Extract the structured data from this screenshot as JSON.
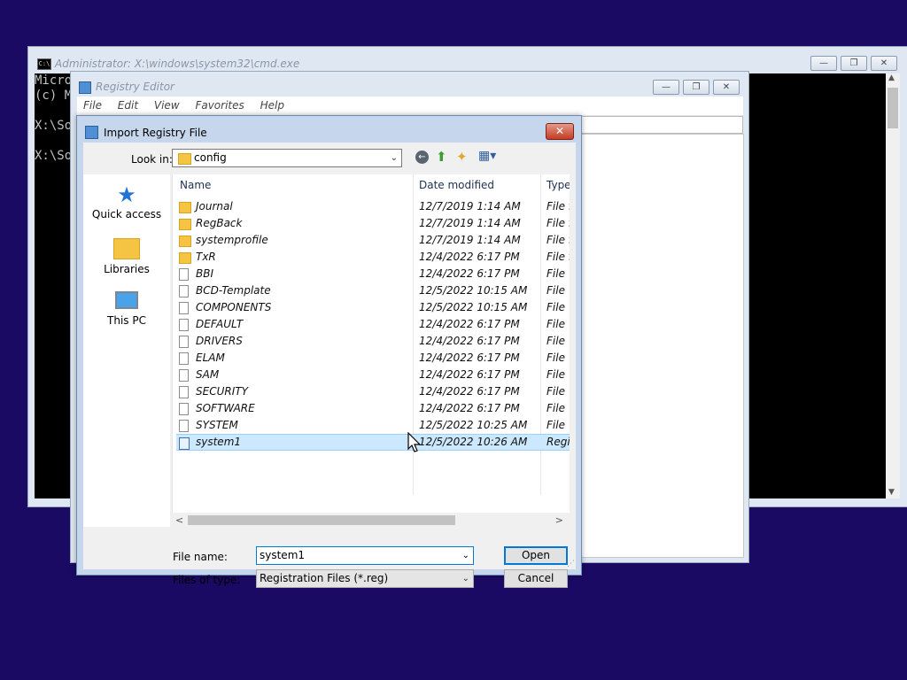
{
  "cmd_window": {
    "title": "Administrator: X:\\windows\\system32\\cmd.exe",
    "lines": [
      "Micro",
      "(c) M",
      "",
      "X:\\So",
      "",
      "X:\\So"
    ],
    "caption_buttons": {
      "minimize": "—",
      "restore": "❐",
      "close": "✕"
    }
  },
  "registry_editor": {
    "title": "Registry Editor",
    "menu": [
      "File",
      "Edit",
      "View",
      "Favorites",
      "Help"
    ],
    "caption_buttons": {
      "minimize": "—",
      "restore": "❐",
      "close": "✕"
    }
  },
  "dialog": {
    "title": "Import Registry File",
    "close_glyph": "✕",
    "look_in_label": "Look in:",
    "look_in_value": "config",
    "places": [
      "Quick access",
      "Libraries",
      "This PC"
    ],
    "columns": {
      "name": "Name",
      "date": "Date modified",
      "type": "Type"
    },
    "files": [
      {
        "name": "Journal",
        "date": "12/7/2019 1:14 AM",
        "type": "File fo",
        "kind": "folder"
      },
      {
        "name": "RegBack",
        "date": "12/7/2019 1:14 AM",
        "type": "File fo",
        "kind": "folder"
      },
      {
        "name": "systemprofile",
        "date": "12/7/2019 1:14 AM",
        "type": "File fo",
        "kind": "folder"
      },
      {
        "name": "TxR",
        "date": "12/4/2022 6:17 PM",
        "type": "File fo",
        "kind": "folder"
      },
      {
        "name": "BBI",
        "date": "12/4/2022 6:17 PM",
        "type": "File",
        "kind": "file"
      },
      {
        "name": "BCD-Template",
        "date": "12/5/2022 10:15 AM",
        "type": "File",
        "kind": "file"
      },
      {
        "name": "COMPONENTS",
        "date": "12/5/2022 10:15 AM",
        "type": "File",
        "kind": "file"
      },
      {
        "name": "DEFAULT",
        "date": "12/4/2022 6:17 PM",
        "type": "File",
        "kind": "file"
      },
      {
        "name": "DRIVERS",
        "date": "12/4/2022 6:17 PM",
        "type": "File",
        "kind": "file"
      },
      {
        "name": "ELAM",
        "date": "12/4/2022 6:17 PM",
        "type": "File",
        "kind": "file"
      },
      {
        "name": "SAM",
        "date": "12/4/2022 6:17 PM",
        "type": "File",
        "kind": "file"
      },
      {
        "name": "SECURITY",
        "date": "12/4/2022 6:17 PM",
        "type": "File",
        "kind": "file"
      },
      {
        "name": "SOFTWARE",
        "date": "12/4/2022 6:17 PM",
        "type": "File",
        "kind": "file"
      },
      {
        "name": "SYSTEM",
        "date": "12/5/2022 10:25 AM",
        "type": "File",
        "kind": "file"
      },
      {
        "name": "system1",
        "date": "12/5/2022 10:26 AM",
        "type": "Regis",
        "kind": "reg",
        "selected": true
      }
    ],
    "file_name_label": "File name:",
    "file_name_value": "system1",
    "files_of_type_label": "Files of type:",
    "files_of_type_value": "Registration Files (*.reg)",
    "open_label": "Open",
    "cancel_label": "Cancel"
  },
  "colors": {
    "desktop": "#1b0a63",
    "selection": "#cce8ff",
    "accent": "#0078d7"
  }
}
